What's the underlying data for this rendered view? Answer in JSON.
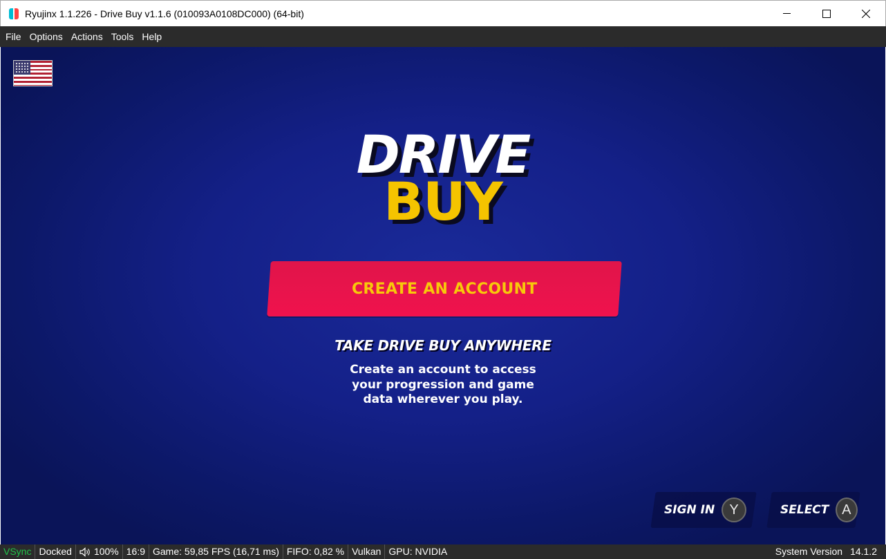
{
  "window": {
    "title": "Ryujinx 1.1.226 - Drive Buy v1.1.6 (010093A0108DC000) (64-bit)",
    "controls": [
      "minimize",
      "maximize",
      "close"
    ]
  },
  "menu": {
    "items": [
      "File",
      "Options",
      "Actions",
      "Tools",
      "Help"
    ]
  },
  "game": {
    "language_flag": "us-flag-icon",
    "logo_line1": "DRIVE",
    "logo_line2": "BUY",
    "create_button": "CREATE AN ACCOUNT",
    "tagline": "TAKE DRIVE BUY ANYWHERE",
    "description_lines": [
      "Create an account to access",
      "your progression and game",
      "data wherever you play."
    ],
    "hints": [
      {
        "label": "SIGN IN",
        "button": "Y"
      },
      {
        "label": "SELECT",
        "button": "A"
      }
    ],
    "colors": {
      "background": "#142088",
      "button": "#f0124d",
      "button_text": "#f7c90a",
      "logo_buy": "#f5c400"
    }
  },
  "status": {
    "vsync": "VSync",
    "dock": "Docked",
    "volume": "100%",
    "aspect": "16:9",
    "game_fps": "Game: 59,85 FPS (16,71 ms)",
    "fifo": "FIFO: 0,82 %",
    "backend": "Vulkan",
    "gpu": "GPU: NVIDIA",
    "system_version_label": "System Version",
    "system_version": "14.1.2",
    "vsync_color": "#21c14a"
  }
}
